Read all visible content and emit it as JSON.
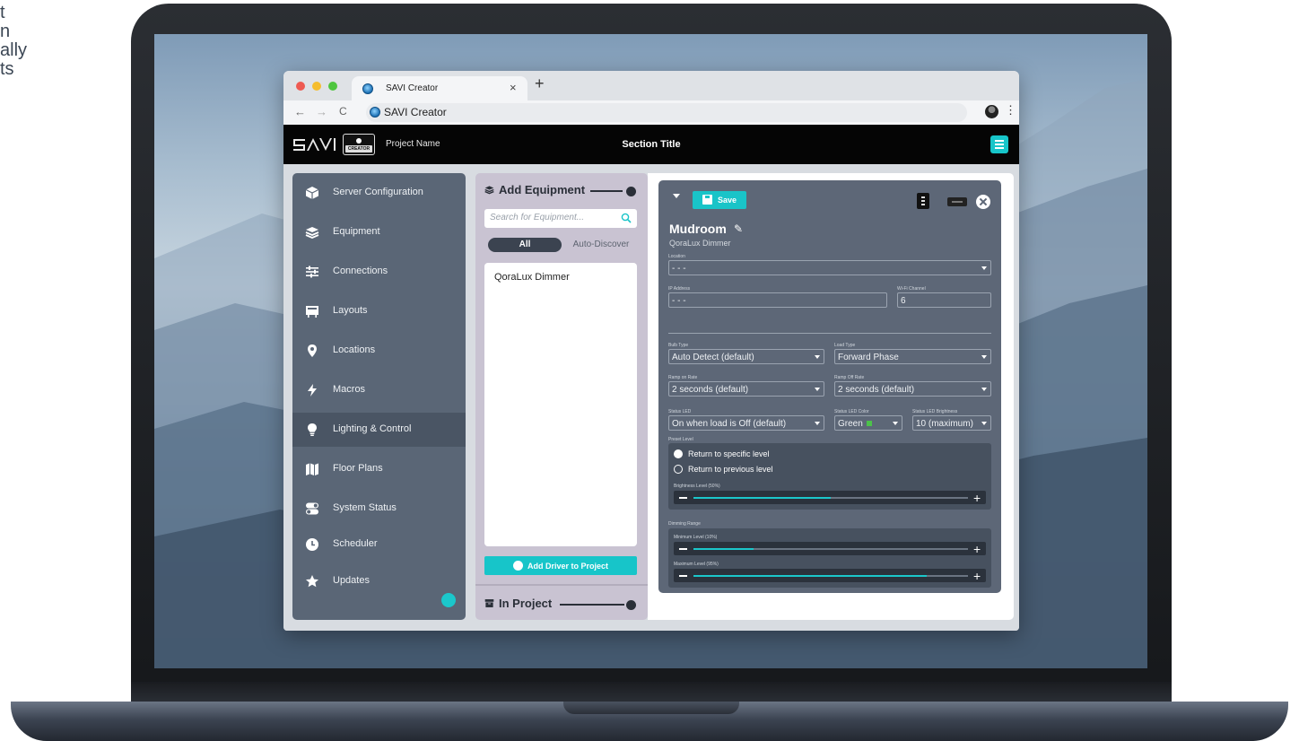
{
  "marketing_text": [
    "t",
    "n",
    "ally",
    "ts"
  ],
  "browser": {
    "tab_title": "SAVI Creator",
    "tab_close": "×",
    "new_tab": "+",
    "address": "SAVI Creator",
    "nav": {
      "back": "←",
      "forward": "→",
      "reload": "C"
    },
    "menu": "⋮"
  },
  "app": {
    "logo_text": "CREATOR",
    "project_name": "Project Name",
    "section_title": "Section Title",
    "sidebar": [
      {
        "label": "Server Configuration",
        "icon": "server-icon"
      },
      {
        "label": "Equipment",
        "icon": "stack-icon"
      },
      {
        "label": "Connections",
        "icon": "sliders-icon"
      },
      {
        "label": "Layouts",
        "icon": "layout-icon"
      },
      {
        "label": "Locations",
        "icon": "map-pin-icon"
      },
      {
        "label": "Macros",
        "icon": "bolt-icon"
      },
      {
        "label": "Lighting & Control",
        "icon": "lightbulb-icon",
        "active": true
      },
      {
        "label": "Floor Plans",
        "icon": "floor-plan-icon"
      },
      {
        "label": "System Status",
        "icon": "toggle-icon"
      },
      {
        "label": "Scheduler",
        "icon": "clock-icon"
      },
      {
        "label": "Updates",
        "icon": "star-icon"
      }
    ],
    "equipment": {
      "heading": "Add Equipment",
      "search_placeholder": "Search for Equipment...",
      "filter_all": "All",
      "filter_auto": "Auto-Discover",
      "results": [
        "QoraLux Dimmer"
      ],
      "add_button": "Add Driver to Project",
      "in_project": "In Project"
    },
    "detail": {
      "save": "Save",
      "device_name": "Mudroom",
      "device_type": "QoraLux Dimmer",
      "location": {
        "label": "Location",
        "value": "- - -"
      },
      "ip": {
        "label": "IP Address",
        "value": "- - -"
      },
      "wifi": {
        "label": "Wi-Fi Channel",
        "value": "6"
      },
      "bulb_type": {
        "label": "Bulb Type",
        "value": "Auto Detect (default)"
      },
      "load_type": {
        "label": "Load Type",
        "value": "Forward Phase"
      },
      "ramp_on": {
        "label": "Ramp on Rate",
        "value": "2 seconds (default)"
      },
      "ramp_off": {
        "label": "Ramp Off Rate",
        "value": "2 seconds (default)"
      },
      "status_led": {
        "label": "Status LED",
        "value": "On when load is Off (default)"
      },
      "status_led_color": {
        "label": "Status LED Color",
        "value": "Green"
      },
      "status_led_brightness": {
        "label": "Status LED Brightness",
        "value": "10 (maximum)"
      },
      "preset": {
        "label": "Preset Level",
        "option1": "Return to specific level",
        "option2": "Return to previous level",
        "selected": 1,
        "brightness_label": "Brightness Level (50%)",
        "brightness": 0.5
      },
      "dimming": {
        "label": "Dimming Range",
        "min_label": "Minimum Level (10%)",
        "min": 0.22,
        "max_label": "Maximum Level (95%)",
        "max": 0.85
      }
    }
  },
  "colors": {
    "accent": "#17c5c9",
    "sidebar": "#5a6676",
    "card": "#5d6777",
    "equipment_panel": "#c9c3d2",
    "header": "#050505",
    "led_green": "#4cc24a"
  }
}
